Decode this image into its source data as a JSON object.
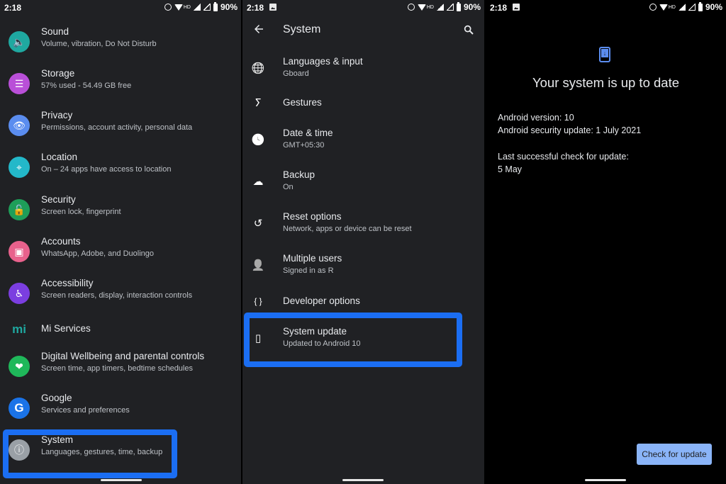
{
  "status_bar": {
    "time": "2:18",
    "battery": "90%",
    "network": "HD"
  },
  "settings": {
    "items": [
      {
        "title": "Sound",
        "subtitle": "Volume, vibration, Do Not Disturb",
        "icon": "volume-icon",
        "color": "#1fa8a0",
        "glyph": "🔈"
      },
      {
        "title": "Storage",
        "subtitle": "57% used - 54.49 GB free",
        "icon": "storage-icon",
        "color": "#b94fd8",
        "glyph": "☰"
      },
      {
        "title": "Privacy",
        "subtitle": "Permissions, account activity, personal data",
        "icon": "privacy-eye-icon",
        "color": "#5b8def",
        "glyph": "👁"
      },
      {
        "title": "Location",
        "subtitle": "On – 24 apps have access to location",
        "icon": "location-pin-icon",
        "color": "#23b8c9",
        "glyph": "⌖"
      },
      {
        "title": "Security",
        "subtitle": "Screen lock, fingerprint",
        "icon": "unlock-icon",
        "color": "#1e9e59",
        "glyph": "🔓"
      },
      {
        "title": "Accounts",
        "subtitle": "WhatsApp, Adobe, and Duolingo",
        "icon": "accounts-icon",
        "color": "#e8618c",
        "glyph": "▣"
      },
      {
        "title": "Accessibility",
        "subtitle": "Screen readers, display, interaction controls",
        "icon": "accessibility-icon",
        "color": "#7b3ee0",
        "glyph": "♿"
      },
      {
        "title": "Mi Services",
        "subtitle": "",
        "icon": "mi-logo-icon",
        "color": "#1fa8a0",
        "glyph": "mi"
      },
      {
        "title": "Digital Wellbeing and parental controls",
        "subtitle": "Screen time, app timers, bedtime schedules",
        "icon": "wellbeing-icon",
        "color": "#1fb85a",
        "glyph": "❤"
      },
      {
        "title": "Google",
        "subtitle": "Services and preferences",
        "icon": "google-icon",
        "color": "#1a73e8",
        "glyph": "G"
      },
      {
        "title": "System",
        "subtitle": "Languages, gestures, time, backup",
        "icon": "info-icon",
        "color": "#9aa0a6",
        "glyph": "ⓘ"
      }
    ]
  },
  "system": {
    "title": "System",
    "items": [
      {
        "title": "Languages & input",
        "subtitle": "Gboard",
        "icon": "globe-icon",
        "glyph": "🌐"
      },
      {
        "title": "Gestures",
        "subtitle": "",
        "icon": "gestures-icon",
        "glyph": "ⵢ"
      },
      {
        "title": "Date & time",
        "subtitle": "GMT+05:30",
        "icon": "clock-icon",
        "glyph": "🕓"
      },
      {
        "title": "Backup",
        "subtitle": "On",
        "icon": "cloud-upload-icon",
        "glyph": "☁"
      },
      {
        "title": "Reset options",
        "subtitle": "Network, apps or device can be reset",
        "icon": "history-icon",
        "glyph": "↺"
      },
      {
        "title": "Multiple users",
        "subtitle": "Signed in as R",
        "icon": "person-icon",
        "glyph": "👤"
      },
      {
        "title": "Developer options",
        "subtitle": "",
        "icon": "braces-icon",
        "glyph": "{ }"
      },
      {
        "title": "System update",
        "subtitle": "Updated to Android 10",
        "icon": "system-update-icon",
        "glyph": "▯"
      }
    ]
  },
  "update": {
    "title": "Your system is up to date",
    "android_version": "Android version: 10",
    "security_update": "Android security update: 1 July 2021",
    "last_check_label": "Last successful check for update:",
    "last_check_value": "5 May",
    "button": "Check for update"
  },
  "colors": {
    "highlight": "#1b6ef3",
    "button_bg": "#8ab4f8",
    "update_icon": "#5b8def"
  }
}
